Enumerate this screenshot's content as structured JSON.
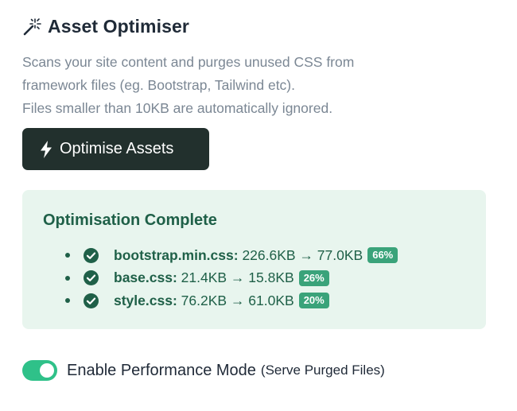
{
  "header": {
    "title": "Asset Optimiser",
    "icon": "magic-wand-icon"
  },
  "description": {
    "lines": [
      "Scans your site content and purges unused CSS from",
      "framework files (eg. Bootstrap, Tailwind etc).",
      "Files smaller than 10KB are automatically ignored."
    ]
  },
  "optimise_button": {
    "label": "Optimise Assets",
    "icon": "lightning-bolt-icon"
  },
  "results": {
    "title": "Optimisation Complete",
    "items": [
      {
        "file": "bootstrap.min.css:",
        "sizes": "226.6KB → 77.0KB",
        "percent": "66%"
      },
      {
        "file": "base.css:",
        "sizes": "21.4KB → 15.8KB",
        "percent": "26%"
      },
      {
        "file": "style.css:",
        "sizes": "76.2KB → 61.0KB",
        "percent": "20%"
      }
    ]
  },
  "performance_mode": {
    "label": "Enable Performance Mode",
    "sublabel": "(Serve Purged Files)",
    "enabled": true
  },
  "colors": {
    "button_bg": "#22302d",
    "result_bg": "#e8f5ee",
    "result_text": "#1f6048",
    "badge_bg": "#3aa37a",
    "toggle_on": "#2fc189"
  }
}
